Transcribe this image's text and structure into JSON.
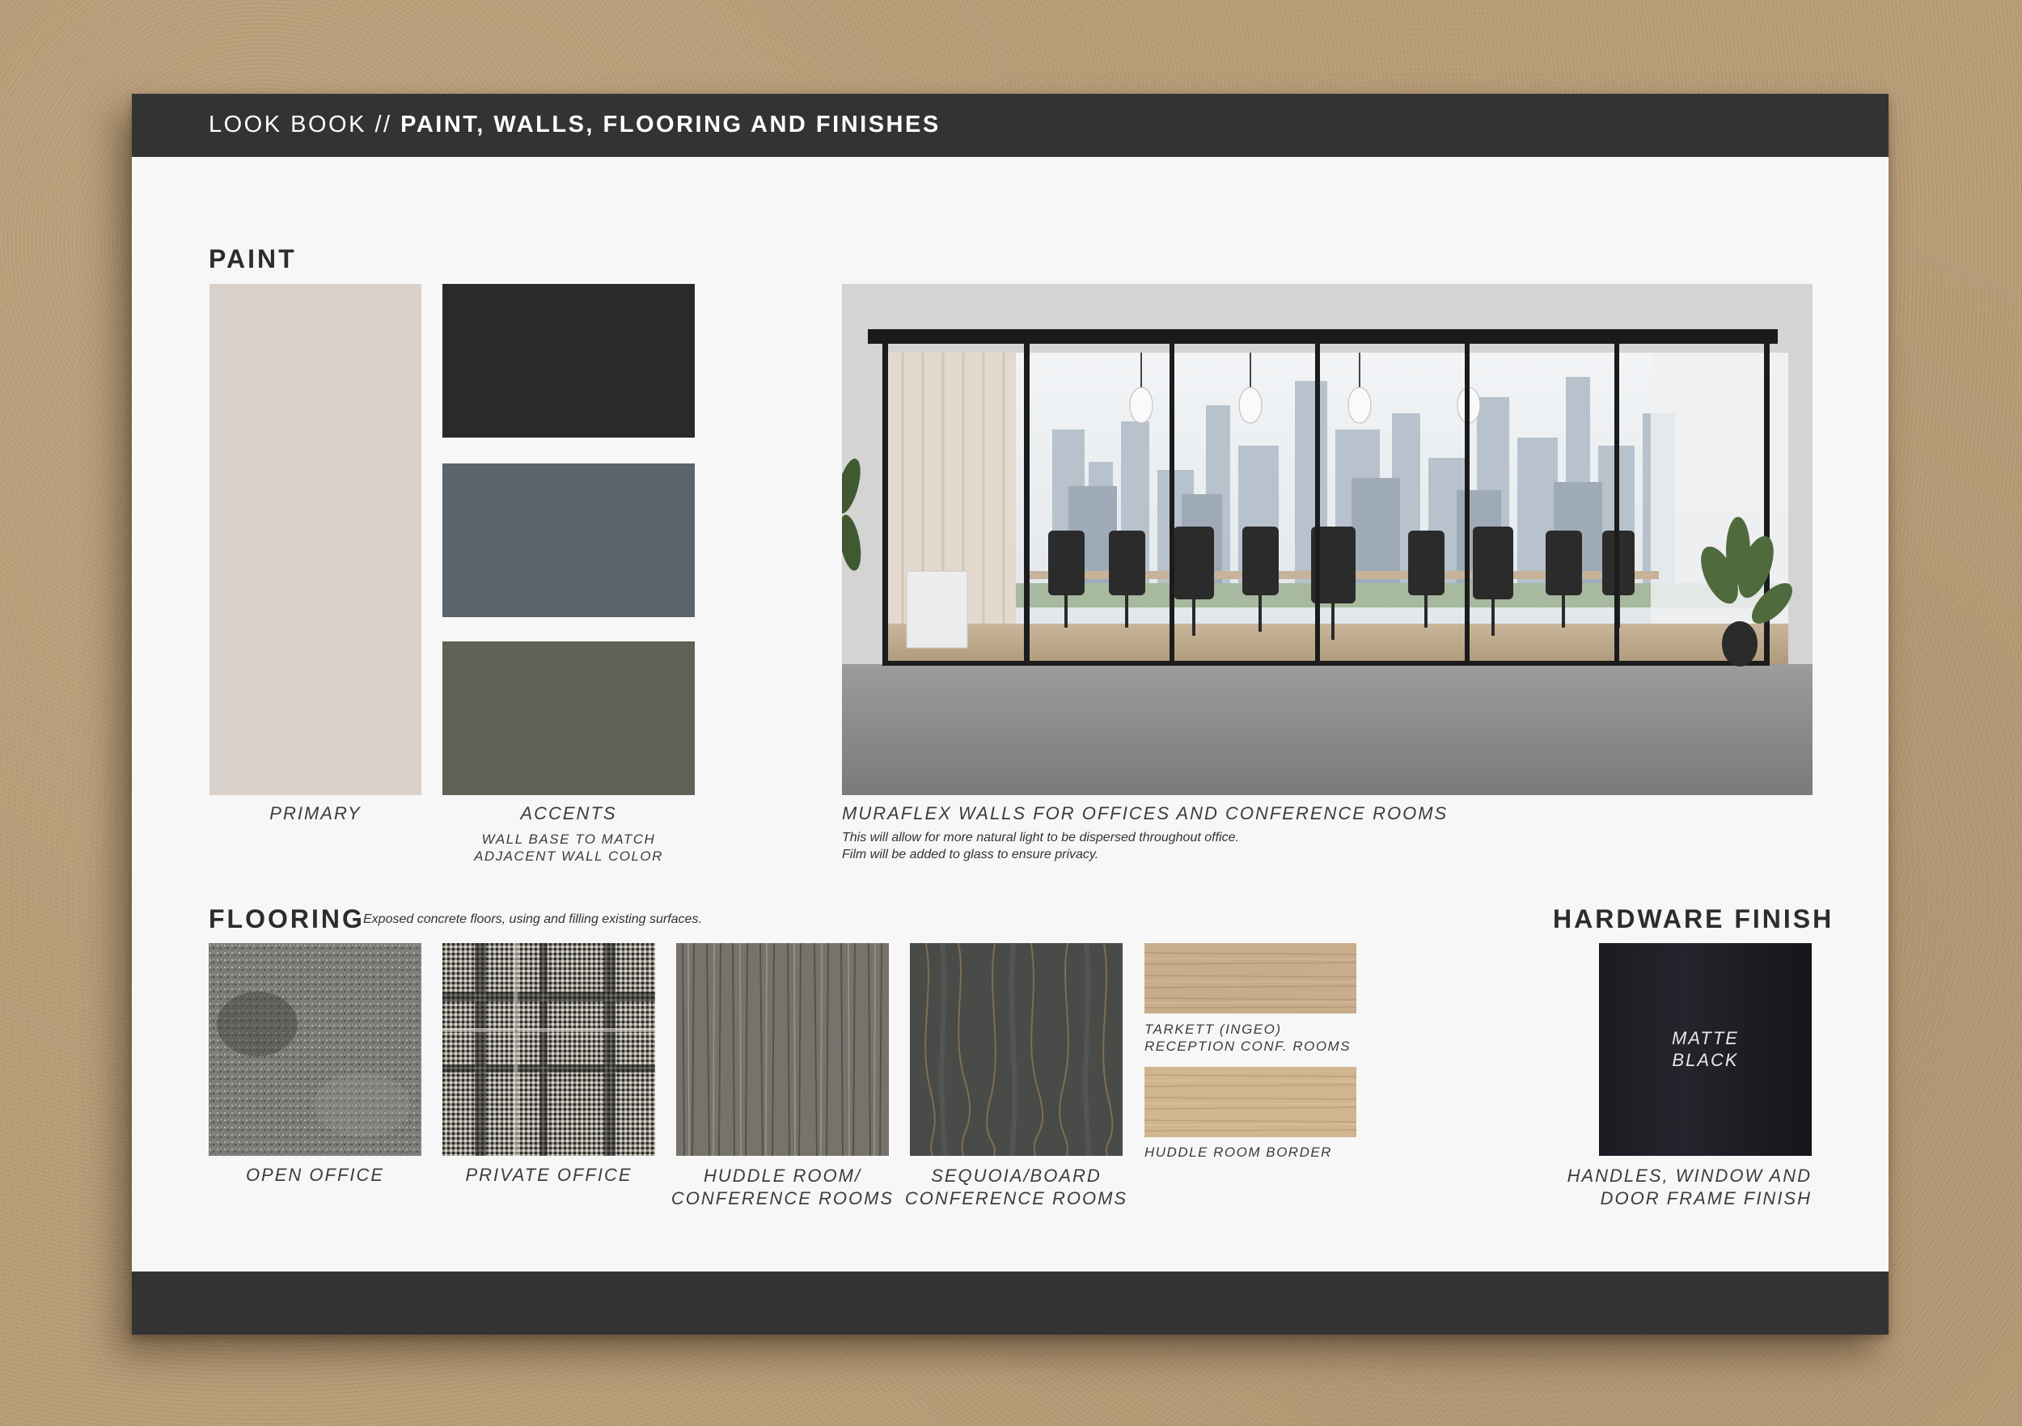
{
  "header": {
    "prefix": "LOOK BOOK // ",
    "title": "PAINT, WALLS, FLOORING AND FINISHES"
  },
  "paint": {
    "heading": "PAINT",
    "primary": {
      "label": "PRIMARY",
      "color": "#d8d1cb"
    },
    "accents": {
      "label": "ACCENTS",
      "note_line1": "WALL BASE TO MATCH",
      "note_line2": "ADJACENT WALL COLOR",
      "colors": [
        "#2a2a2c",
        "#5b636b",
        "#5f6355"
      ]
    }
  },
  "walls": {
    "label": "MURAFLEX WALLS FOR OFFICES AND CONFERENCE ROOMS",
    "note_line1": "This will allow for more natural light to be dispersed throughout office.",
    "note_line2": "Film will be added to glass to ensure privacy."
  },
  "flooring": {
    "heading": "FLOORING",
    "note": "Exposed concrete floors, using and filling existing surfaces.",
    "items": [
      {
        "line1": "OPEN OFFICE",
        "line2": ""
      },
      {
        "line1": "PRIVATE OFFICE",
        "line2": ""
      },
      {
        "line1": "HUDDLE ROOM/",
        "line2": "CONFERENCE ROOMS"
      },
      {
        "line1": "SEQUOIA/BOARD",
        "line2": "CONFERENCE ROOMS"
      }
    ],
    "wood": [
      {
        "line1": "TARKETT (INGEO)",
        "line2": "RECEPTION CONF. ROOMS"
      },
      {
        "line1": "HUDDLE ROOM BORDER",
        "line2": ""
      }
    ]
  },
  "hardware": {
    "heading": "HARDWARE FINISH",
    "swatch_line1": "MATTE",
    "swatch_line2": "BLACK",
    "caption_line1": "HANDLES, WINDOW AND",
    "caption_line2": "DOOR FRAME FINISH",
    "color": "#1c1c22"
  }
}
